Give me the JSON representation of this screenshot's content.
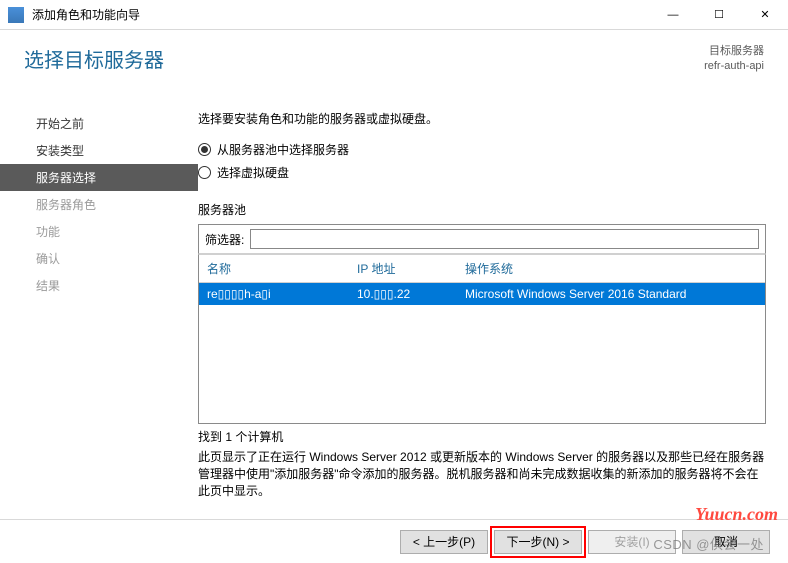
{
  "window": {
    "title": "添加角色和功能向导",
    "min_glyph": "—",
    "max_glyph": "☐",
    "close_glyph": "✕"
  },
  "header": {
    "page_title": "选择目标服务器",
    "target_label": "目标服务器",
    "target_value": "refr-auth-api"
  },
  "sidebar": {
    "items": [
      {
        "label": "开始之前"
      },
      {
        "label": "安装类型"
      },
      {
        "label": "服务器选择"
      },
      {
        "label": "服务器角色"
      },
      {
        "label": "功能"
      },
      {
        "label": "确认"
      },
      {
        "label": "结果"
      }
    ]
  },
  "main": {
    "instruction": "选择要安装角色和功能的服务器或虚拟硬盘。",
    "radio1": "从服务器池中选择服务器",
    "radio2": "选择虚拟硬盘",
    "pool_label": "服务器池",
    "filter_label": "筛选器:",
    "filter_value": "",
    "grid_headers": {
      "name": "名称",
      "ip": "IP 地址",
      "os": "操作系统"
    },
    "rows": [
      {
        "name": "re▯▯▯▯h-a▯i",
        "ip": "10.▯▯▯.22",
        "os": "Microsoft Windows Server 2016 Standard"
      }
    ],
    "found_count": "找到 1 个计算机",
    "note": "此页显示了正在运行 Windows Server 2012 或更新版本的 Windows Server 的服务器以及那些已经在服务器管理器中使用\"添加服务器\"命令添加的服务器。脱机服务器和尚未完成数据收集的新添加的服务器将不会在此页中显示。"
  },
  "buttons": {
    "prev": "< 上一步(P)",
    "next": "下一步(N) >",
    "install": "安装(I)",
    "cancel": "取消"
  },
  "watermarks": {
    "site": "Yuucn.com",
    "csdn": "CSDN @俱会一处"
  }
}
